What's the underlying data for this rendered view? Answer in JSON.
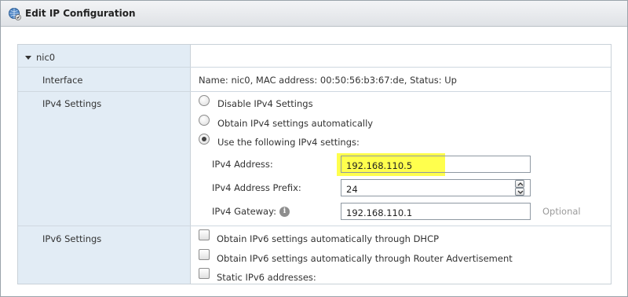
{
  "window": {
    "title": "Edit IP Configuration"
  },
  "nic": {
    "name": "nic0"
  },
  "rows": {
    "interface_label": "Interface",
    "interface_value": "Name: nic0, MAC address: 00:50:56:b3:67:de, Status: Up",
    "ipv4_label": "IPv4 Settings",
    "ipv6_label": "IPv6 Settings"
  },
  "ipv4": {
    "options": [
      {
        "label": "Disable IPv4 Settings",
        "selected": false
      },
      {
        "label": "Obtain IPv4 settings automatically",
        "selected": false
      },
      {
        "label": "Use the following IPv4 settings:",
        "selected": true
      }
    ],
    "address_label": "IPv4 Address:",
    "address_value": "192.168.110.5",
    "prefix_label": "IPv4 Address Prefix:",
    "prefix_value": "24",
    "gateway_label": "IPv4 Gateway:",
    "gateway_value": "192.168.110.1",
    "gateway_hint": "Optional"
  },
  "ipv6": {
    "options": [
      {
        "label": "Obtain IPv6 settings automatically through DHCP",
        "checked": false
      },
      {
        "label": "Obtain IPv6 settings automatically through Router Advertisement",
        "checked": false
      },
      {
        "label": "Static IPv6 addresses:",
        "checked": false
      }
    ]
  },
  "colors": {
    "highlight": "#ffff4d",
    "label_column": "#e2ecf5"
  }
}
